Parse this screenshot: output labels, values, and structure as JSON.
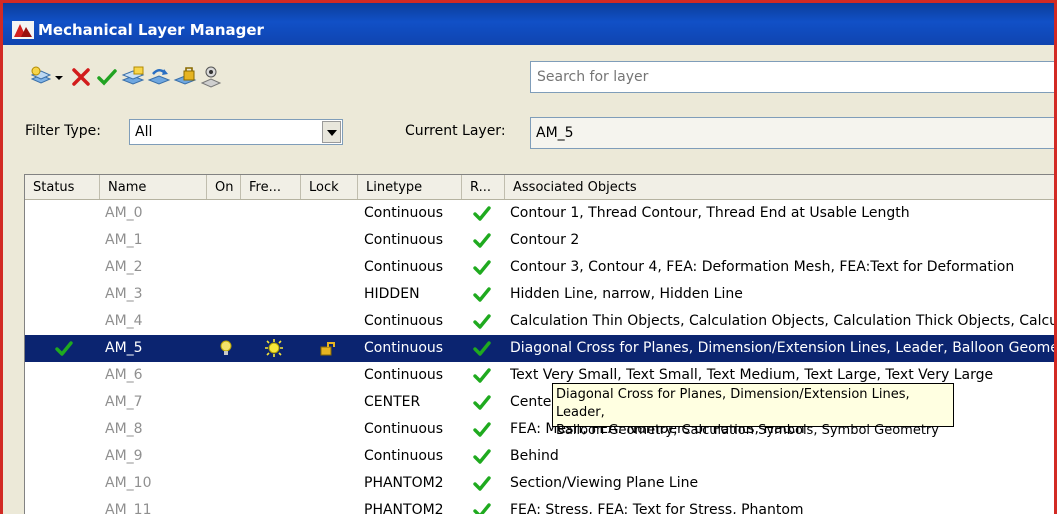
{
  "window": {
    "title": "Mechanical Layer Manager"
  },
  "toolbar": {
    "icons": [
      "new-layer-icon",
      "dropdown-arrow-icon",
      "delete-icon",
      "set-current-icon",
      "layer-states-icon",
      "refresh-icon",
      "lock-objects-icon",
      "layer-walk-icon"
    ]
  },
  "search": {
    "placeholder": "Search for layer"
  },
  "filter": {
    "label": "Filter Type:",
    "value": "All"
  },
  "current_layer": {
    "label": "Current Layer:",
    "value": "AM_5"
  },
  "columns": [
    "Status",
    "Name",
    "On",
    "Fre...",
    "Lock",
    "Linetype",
    "R...",
    "Associated Objects"
  ],
  "rows": [
    {
      "name": "AM_0",
      "linetype": "Continuous",
      "objects": "Contour 1, Thread Contour, Thread End at Usable Length"
    },
    {
      "name": "AM_1",
      "linetype": "Continuous",
      "objects": "Contour 2"
    },
    {
      "name": "AM_2",
      "linetype": "Continuous",
      "objects": "Contour 3, Contour 4, FEA: Deformation Mesh, FEA:Text for Deformation"
    },
    {
      "name": "AM_3",
      "linetype": "HIDDEN",
      "objects": "Hidden Line, narrow, Hidden Line"
    },
    {
      "name": "AM_4",
      "linetype": "Continuous",
      "objects": "Calculation Thin Objects, Calculation Objects, Calculation Thick Objects, Calculation V..."
    },
    {
      "name": "AM_5",
      "linetype": "Continuous",
      "objects": "Diagonal Cross for Planes, Dimension/Extension Lines, Leader, Balloon Geometry, Calc...",
      "selected": true
    },
    {
      "name": "AM_6",
      "linetype": "Continuous",
      "objects": "Text Very Small, Text Small, Text Medium, Text Large, Text Very Large"
    },
    {
      "name": "AM_7",
      "linetype": "CENTER",
      "objects": "Centerline, Center Line, Pitch Circle, Reference Circle for ..."
    },
    {
      "name": "AM_8",
      "linetype": "Continuous",
      "objects": "FEA: Mesh, FEA: Numbers of Points, Hatch"
    },
    {
      "name": "AM_9",
      "linetype": "Continuous",
      "objects": "Behind"
    },
    {
      "name": "AM_10",
      "linetype": "PHANTOM2",
      "objects": "Section/Viewing Plane Line"
    },
    {
      "name": "AM_11",
      "linetype": "PHANTOM2",
      "objects": "FEA: Stress, FEA: Text for Stress, Phantom"
    }
  ],
  "tooltip": {
    "line1": "Diagonal Cross for Planes, Dimension/Extension Lines, Leader,",
    "line2": "Balloon Geometry, Calculation Symbols, Symbol Geometry"
  },
  "colors": {
    "titlebar": "#1150c7",
    "selection": "#0b2470",
    "check": "#1faa1f",
    "border": "#d22a24"
  }
}
